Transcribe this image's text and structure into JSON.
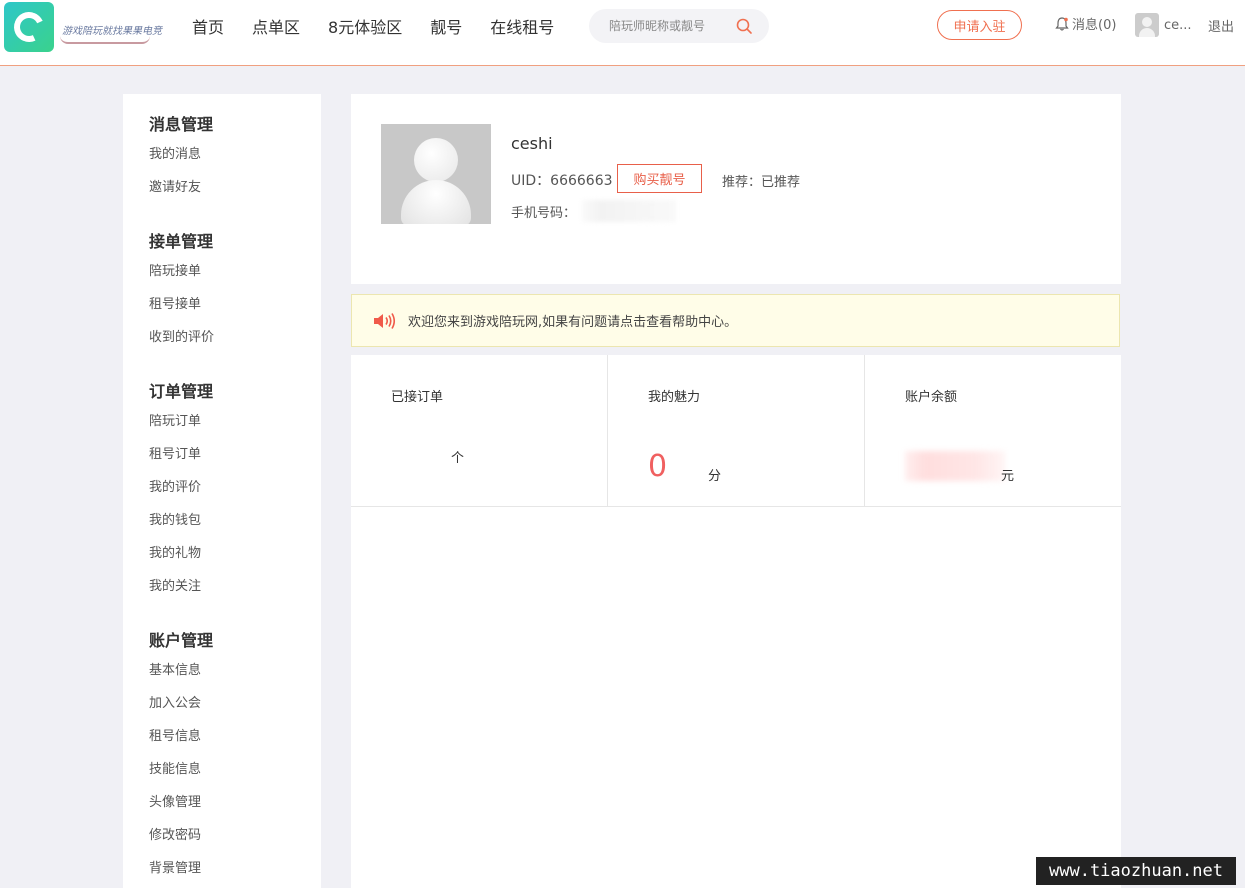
{
  "header": {
    "logo_text": "游戏陪玩就找果果电竞",
    "nav": [
      "首页",
      "点单区",
      "8元体验区",
      "靓号",
      "在线租号"
    ],
    "search_placeholder": "陪玩师昵称或靓号",
    "apply_label": "申请入驻",
    "messages_label": "消息(0)",
    "username": "ce...",
    "logout_label": "退出"
  },
  "sidebar": {
    "groups": [
      {
        "title": "消息管理",
        "items": [
          "我的消息",
          "邀请好友"
        ]
      },
      {
        "title": "接单管理",
        "items": [
          "陪玩接单",
          "租号接单",
          "收到的评价"
        ]
      },
      {
        "title": "订单管理",
        "items": [
          "陪玩订单",
          "租号订单",
          "我的评价",
          "我的钱包",
          "我的礼物",
          "我的关注"
        ]
      },
      {
        "title": "账户管理",
        "items": [
          "基本信息",
          "加入公会",
          "租号信息",
          "技能信息",
          "头像管理",
          "修改密码",
          "背景管理"
        ]
      }
    ]
  },
  "profile": {
    "name": "ceshi",
    "uid": "UID：6666663",
    "buy_label": "购买靓号",
    "recommend": "推荐：已推荐",
    "phone_label": "手机号码："
  },
  "notice": {
    "text": "欢迎您来到游戏陪玩网,如果有问题请点击查看帮助中心。"
  },
  "stats": {
    "orders_label": "已接订单",
    "orders_unit": "个",
    "charm_label": "我的魅力",
    "charm_value": "0",
    "charm_unit": "分",
    "balance_label": "账户余额",
    "balance_unit": "元"
  },
  "watermark": "www.tiaozhuan.net",
  "colors": {
    "accent": "#f07050",
    "charm": "#f06060",
    "notice_bg": "#fffde8",
    "page_bg": "#f0f0f5"
  }
}
